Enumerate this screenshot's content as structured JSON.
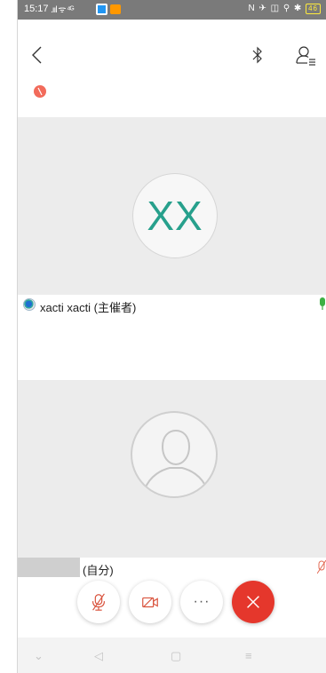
{
  "status_bar": {
    "time": "15:17",
    "signal_text": ".ııl ᯤ ⁴ᴳ",
    "right_icons": "N ✈ ◫ ⚲ ✱",
    "battery": "46"
  },
  "header": {
    "back_icon": "chevron-left-icon",
    "bluetooth_icon": "bluetooth-icon",
    "participants_icon": "participants-list-icon",
    "record_indicator_color": "#f26b5b"
  },
  "participants": [
    {
      "initials": "XX",
      "name": "xacti xacti (主催者)",
      "avatar_color": "#27a08c",
      "mic_state": "active",
      "mic_color": "#3cb043"
    },
    {
      "name_suffix": "(自分)",
      "mic_state": "muted",
      "mic_color": "#e36b55"
    }
  ],
  "controls": {
    "more_label": "···",
    "end_color": "#e5372c",
    "accent_muted": "#d9533d"
  },
  "nav": {
    "down": "⌄",
    "back": "◁",
    "home": "▢",
    "menu": "≡"
  }
}
